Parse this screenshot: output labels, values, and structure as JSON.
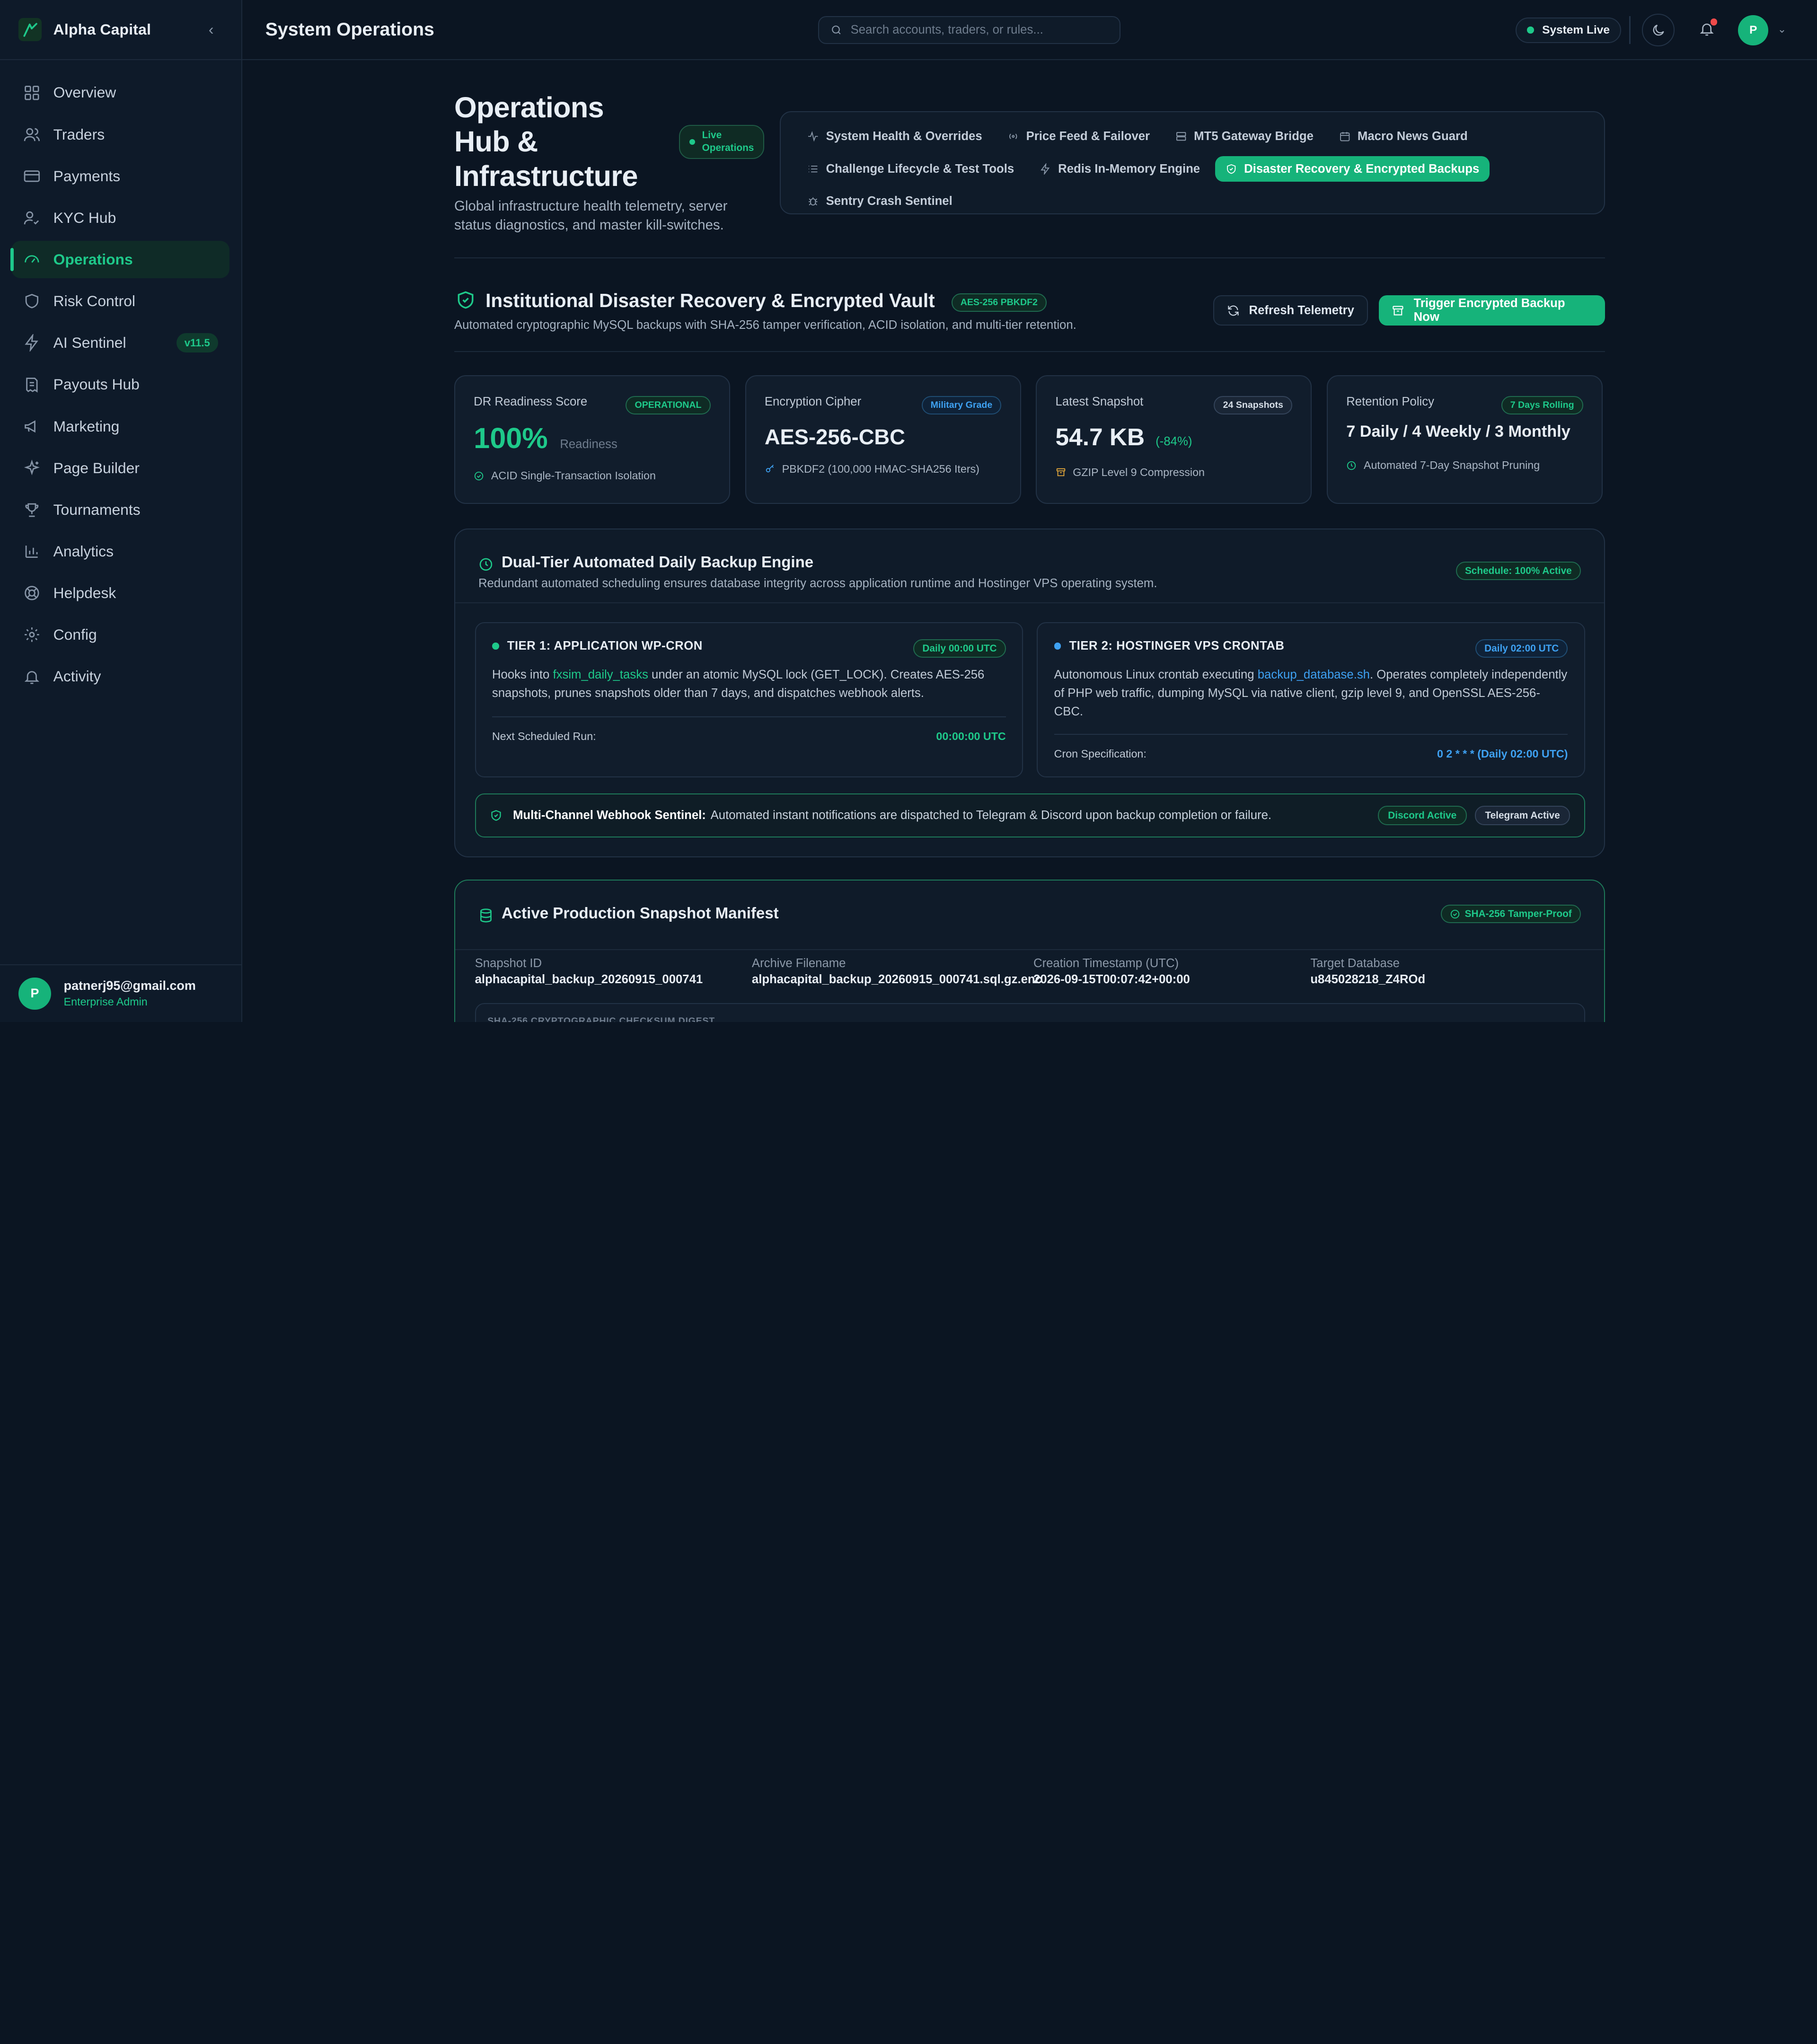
{
  "brand": {
    "name": "Alpha Capital"
  },
  "sidebar": {
    "items": [
      {
        "label": "Overview"
      },
      {
        "label": "Traders"
      },
      {
        "label": "Payments"
      },
      {
        "label": "KYC Hub"
      },
      {
        "label": "Operations"
      },
      {
        "label": "Risk Control"
      },
      {
        "label": "AI Sentinel",
        "badge": "v11.5"
      },
      {
        "label": "Payouts Hub"
      },
      {
        "label": "Marketing"
      },
      {
        "label": "Page Builder"
      },
      {
        "label": "Tournaments"
      },
      {
        "label": "Analytics"
      },
      {
        "label": "Helpdesk"
      },
      {
        "label": "Config"
      },
      {
        "label": "Activity"
      }
    ],
    "user": {
      "initial": "P",
      "email": "patnerj95@gmail.com",
      "role": "Enterprise Admin"
    }
  },
  "header": {
    "title": "System Operations",
    "search_placeholder": "Search accounts, traders, or rules...",
    "status": "System Live",
    "avatar_initial": "P"
  },
  "hero": {
    "title": "Operations Hub & Infrastructure",
    "badge_line1": "Live",
    "badge_line2": "Operations",
    "subtitle": "Global infrastructure health telemetry, server status diagnostics, and master kill-switches."
  },
  "tabs": [
    {
      "label": "System Health & Overrides"
    },
    {
      "label": "Price Feed & Failover"
    },
    {
      "label": "MT5 Gateway Bridge"
    },
    {
      "label": "Macro News Guard"
    },
    {
      "label": "Challenge Lifecycle & Test Tools"
    },
    {
      "label": "Redis In-Memory Engine"
    },
    {
      "label": "Disaster Recovery & Encrypted Backups"
    },
    {
      "label": "Sentry Crash Sentinel"
    }
  ],
  "section": {
    "title": "Institutional Disaster Recovery & Encrypted Vault",
    "badge": "AES-256 PBKDF2",
    "subtitle": "Automated cryptographic MySQL backups with SHA-256 tamper verification, ACID isolation, and multi-tier retention.",
    "refresh_label": "Refresh Telemetry",
    "trigger_label": "Trigger Encrypted Backup Now"
  },
  "stats": [
    {
      "label": "DR Readiness Score",
      "badge": "OPERATIONAL",
      "value": "100%",
      "suffix": "Readiness",
      "foot": "ACID Single-Transaction Isolation"
    },
    {
      "label": "Encryption Cipher",
      "badge": "Military Grade",
      "value": "AES-256-CBC",
      "foot": "PBKDF2 (100,000 HMAC-SHA256 Iters)"
    },
    {
      "label": "Latest Snapshot",
      "badge": "24 Snapshots",
      "value": "54.7 KB",
      "suffix": "(-84%)",
      "foot": "GZIP Level 9 Compression"
    },
    {
      "label": "Retention Policy",
      "badge": "7 Days Rolling",
      "value": "7 Daily / 4 Weekly / 3 Monthly",
      "foot": "Automated 7-Day Snapshot Pruning"
    }
  ],
  "engine": {
    "title": "Dual-Tier Automated Daily Backup Engine",
    "subtitle": "Redundant automated scheduling ensures database integrity across application runtime and Hostinger VPS operating system.",
    "badge": "Schedule: 100% Active",
    "tier1": {
      "title": "TIER 1: APPLICATION WP-CRON",
      "badge": "Daily 00:00 UTC",
      "desc_a": "Hooks into ",
      "desc_kw": "fxsim_daily_tasks",
      "desc_b": " under an atomic MySQL lock (GET_LOCK). Creates AES-256 snapshots, prunes snapshots older than 7 days, and dispatches webhook alerts.",
      "foot_label": "Next Scheduled Run:",
      "foot_value": "00:00:00 UTC"
    },
    "tier2": {
      "title": "TIER 2: HOSTINGER VPS CRONTAB",
      "badge": "Daily 02:00 UTC",
      "desc_a": "Autonomous Linux crontab executing ",
      "desc_kw": "backup_database.sh",
      "desc_b": ". Operates completely independently of PHP web traffic, dumping MySQL via native client, gzip level 9, and OpenSSL AES-256-CBC.",
      "foot_label": "Cron Specification:",
      "foot_value": "0 2 * * * (Daily 02:00 UTC)"
    },
    "webhook": {
      "label": "Multi-Channel Webhook Sentinel:",
      "text": "Automated instant notifications are dispatched to Telegram & Discord upon backup completion or failure.",
      "badge_discord": "Discord Active",
      "badge_telegram": "Telegram Active"
    }
  },
  "manifest": {
    "title": "Active Production Snapshot Manifest",
    "badge": "SHA-256 Tamper-Proof",
    "columns": [
      {
        "label": "Snapshot ID",
        "value": "alphacapital_backup_20260915_000741"
      },
      {
        "label": "Archive Filename",
        "value": "alphacapital_backup_20260915_000741.sql.gz.enc"
      },
      {
        "label": "Creation Timestamp (UTC)",
        "value": "2026-09-15T00:07:42+00:00"
      },
      {
        "label": "Target Database",
        "value": "u845028218_Z4ROd"
      }
    ],
    "digest_label": "SHA-256 CRYPTOGRAPHIC CHECKSUM DIGEST"
  },
  "colors": {
    "accent": "#1ec98a",
    "background": "#0b1522",
    "link_blue": "#3ea1f2"
  }
}
